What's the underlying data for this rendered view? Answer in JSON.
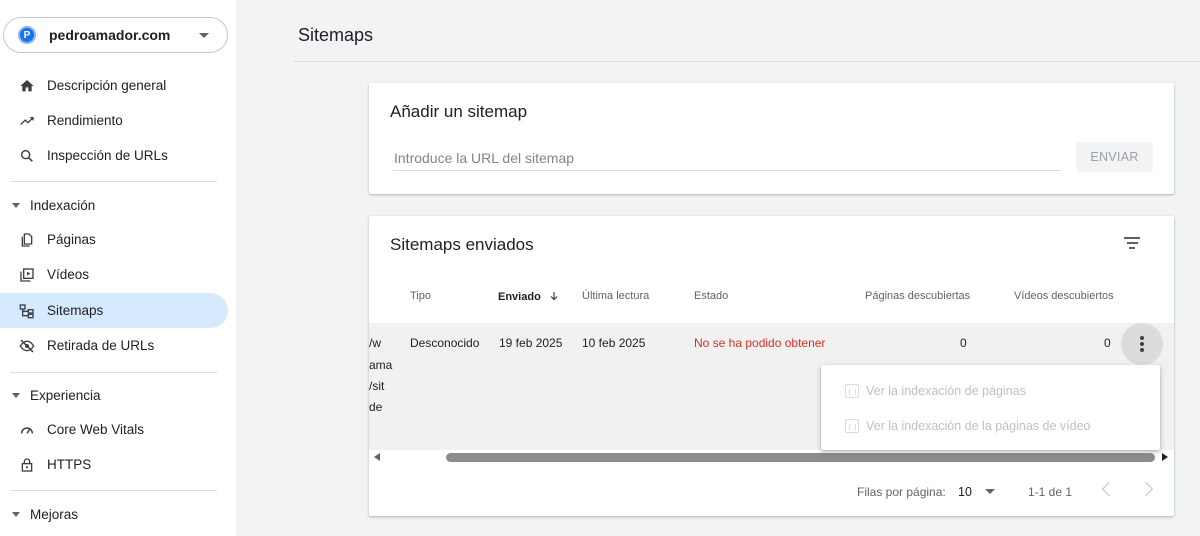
{
  "property": {
    "name": "pedroamador.com",
    "logo_letter": "P"
  },
  "sidebar": {
    "items_top": [
      {
        "label": "Descripción general",
        "icon": "home-icon"
      },
      {
        "label": "Rendimiento",
        "icon": "trending-up-icon"
      },
      {
        "label": "Inspección de URLs",
        "icon": "search-icon"
      }
    ],
    "sections": [
      {
        "label": "Indexación"
      },
      {
        "label": "Experiencia"
      },
      {
        "label": "Mejoras"
      }
    ],
    "indexing_items": [
      {
        "label": "Páginas",
        "icon": "pages-icon"
      },
      {
        "label": "Vídeos",
        "icon": "video-icon"
      },
      {
        "label": "Sitemaps",
        "icon": "sitemap-icon",
        "active": true
      },
      {
        "label": "Retirada de URLs",
        "icon": "eye-off-icon"
      }
    ],
    "experience_items": [
      {
        "label": "Core Web Vitals",
        "icon": "gauge-icon"
      },
      {
        "label": "HTTPS",
        "icon": "lock-icon"
      }
    ]
  },
  "header": {
    "title": "Sitemaps"
  },
  "add_sitemap": {
    "title": "Añadir un sitemap",
    "input_placeholder": "Introduce la URL del sitemap",
    "submit_label": "ENVIAR"
  },
  "submitted": {
    "title": "Sitemaps enviados",
    "columns": {
      "type": "Tipo",
      "sent": "Enviado",
      "last_read": "Última lectura",
      "status": "Estado",
      "pages": "Páginas descubiertas",
      "videos": "Vídeos descubiertos"
    },
    "row": {
      "sitemap_fragments": [
        "/w",
        "ama",
        "/sit",
        "de"
      ],
      "type": "Desconocido",
      "sent": "19 feb 2025",
      "last_read": "10 feb 2025",
      "status": "No se ha podido obtener",
      "pages": "0",
      "videos": "0"
    },
    "pagination": {
      "rows_label": "Filas por página:",
      "rows_value": "10",
      "range": "1-1 de 1"
    }
  },
  "context_menu": {
    "items": [
      {
        "label": "Ver la indexación de páginas"
      },
      {
        "label": "Ver la indexación de la páginas de vídeo"
      }
    ]
  }
}
